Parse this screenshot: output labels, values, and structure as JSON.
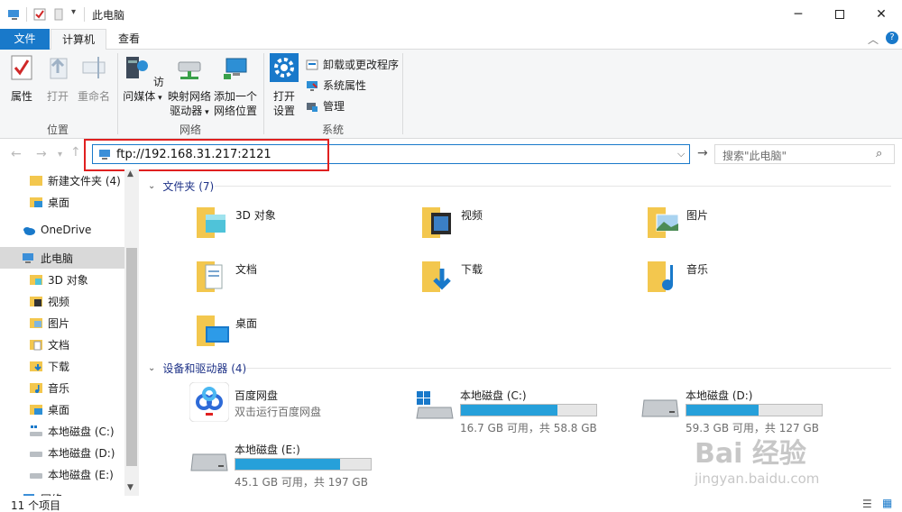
{
  "window": {
    "title": "此电脑",
    "minimize_icon": "minimize-icon",
    "maximize_icon": "maximize-icon",
    "close_icon": "close-icon"
  },
  "ribbon_tabs": [
    {
      "label": "文件"
    },
    {
      "label": "计算机"
    },
    {
      "label": "查看"
    }
  ],
  "ribbon": {
    "location_group": {
      "label": "位置",
      "buttons": [
        "属性",
        "打开",
        "重命名"
      ]
    },
    "network_group": {
      "label": "网络",
      "access_media": "访问媒体",
      "map_drive_line1": "映射网络",
      "map_drive_line2": "驱动器",
      "add_location_line1": "添加一个",
      "add_location_line2": "网络位置"
    },
    "system_group": {
      "label": "系统",
      "open_settings_line1": "打开",
      "open_settings_line2": "设置",
      "uninstall": "卸载或更改程序",
      "system_properties": "系统属性",
      "manage": "管理"
    }
  },
  "address": {
    "value": "ftp://192.168.31.217:2121",
    "search_placeholder": "搜索\"此电脑\""
  },
  "sidebar": {
    "items": [
      {
        "label": "新建文件夹 (4)",
        "icon": "folder-icon",
        "level": 2
      },
      {
        "label": "桌面",
        "icon": "desktop-folder-icon",
        "level": 2
      },
      {
        "label": "OneDrive",
        "icon": "onedrive-cloud-icon",
        "level": 1
      },
      {
        "label": "此电脑",
        "icon": "this-pc-icon",
        "level": 1,
        "selected": true
      },
      {
        "label": "3D 对象",
        "icon": "3d-objects-icon",
        "level": 2
      },
      {
        "label": "视频",
        "icon": "videos-icon",
        "level": 2
      },
      {
        "label": "图片",
        "icon": "pictures-icon",
        "level": 2
      },
      {
        "label": "文档",
        "icon": "documents-icon",
        "level": 2
      },
      {
        "label": "下载",
        "icon": "downloads-icon",
        "level": 2
      },
      {
        "label": "音乐",
        "icon": "music-icon",
        "level": 2
      },
      {
        "label": "桌面",
        "icon": "desktop-folder-icon",
        "level": 2
      },
      {
        "label": "本地磁盘 (C:)",
        "icon": "drive-c-icon",
        "level": 2
      },
      {
        "label": "本地磁盘 (D:)",
        "icon": "drive-icon",
        "level": 2
      },
      {
        "label": "本地磁盘 (E:)",
        "icon": "drive-icon",
        "level": 2
      },
      {
        "label": "网络",
        "icon": "network-icon",
        "level": 1
      }
    ]
  },
  "content": {
    "folders_header": "文件夹 (7)",
    "folders": [
      {
        "label": "3D 对象",
        "icon": "3d-objects-folder-icon"
      },
      {
        "label": "视频",
        "icon": "videos-folder-icon"
      },
      {
        "label": "图片",
        "icon": "pictures-folder-icon"
      },
      {
        "label": "文档",
        "icon": "documents-folder-icon"
      },
      {
        "label": "下载",
        "icon": "downloads-folder-icon"
      },
      {
        "label": "音乐",
        "icon": "music-folder-icon"
      },
      {
        "label": "桌面",
        "icon": "desktop-folder-icon"
      }
    ],
    "devices_header": "设备和驱动器 (4)",
    "baidu": {
      "name": "百度网盘",
      "desc": "双击运行百度网盘"
    },
    "drives": [
      {
        "name": "本地磁盘 (C:)",
        "status": "16.7 GB 可用，共 58.8 GB",
        "used_fraction": 0.716
      },
      {
        "name": "本地磁盘 (D:)",
        "status": "59.3 GB 可用，共 127 GB",
        "used_fraction": 0.533
      },
      {
        "name": "本地磁盘 (E:)",
        "status": "45.1 GB 可用，共 197 GB",
        "used_fraction": 0.771
      }
    ]
  },
  "status": {
    "item_count": "11 个项目"
  },
  "watermark": {
    "text": "Bai 经验",
    "sub": "jingyan.baidu.com"
  },
  "colors": {
    "accent": "#1979ca",
    "selection": "#d9d9d9",
    "drive_fill": "#26a0da",
    "highlight_box": "#e02020"
  }
}
